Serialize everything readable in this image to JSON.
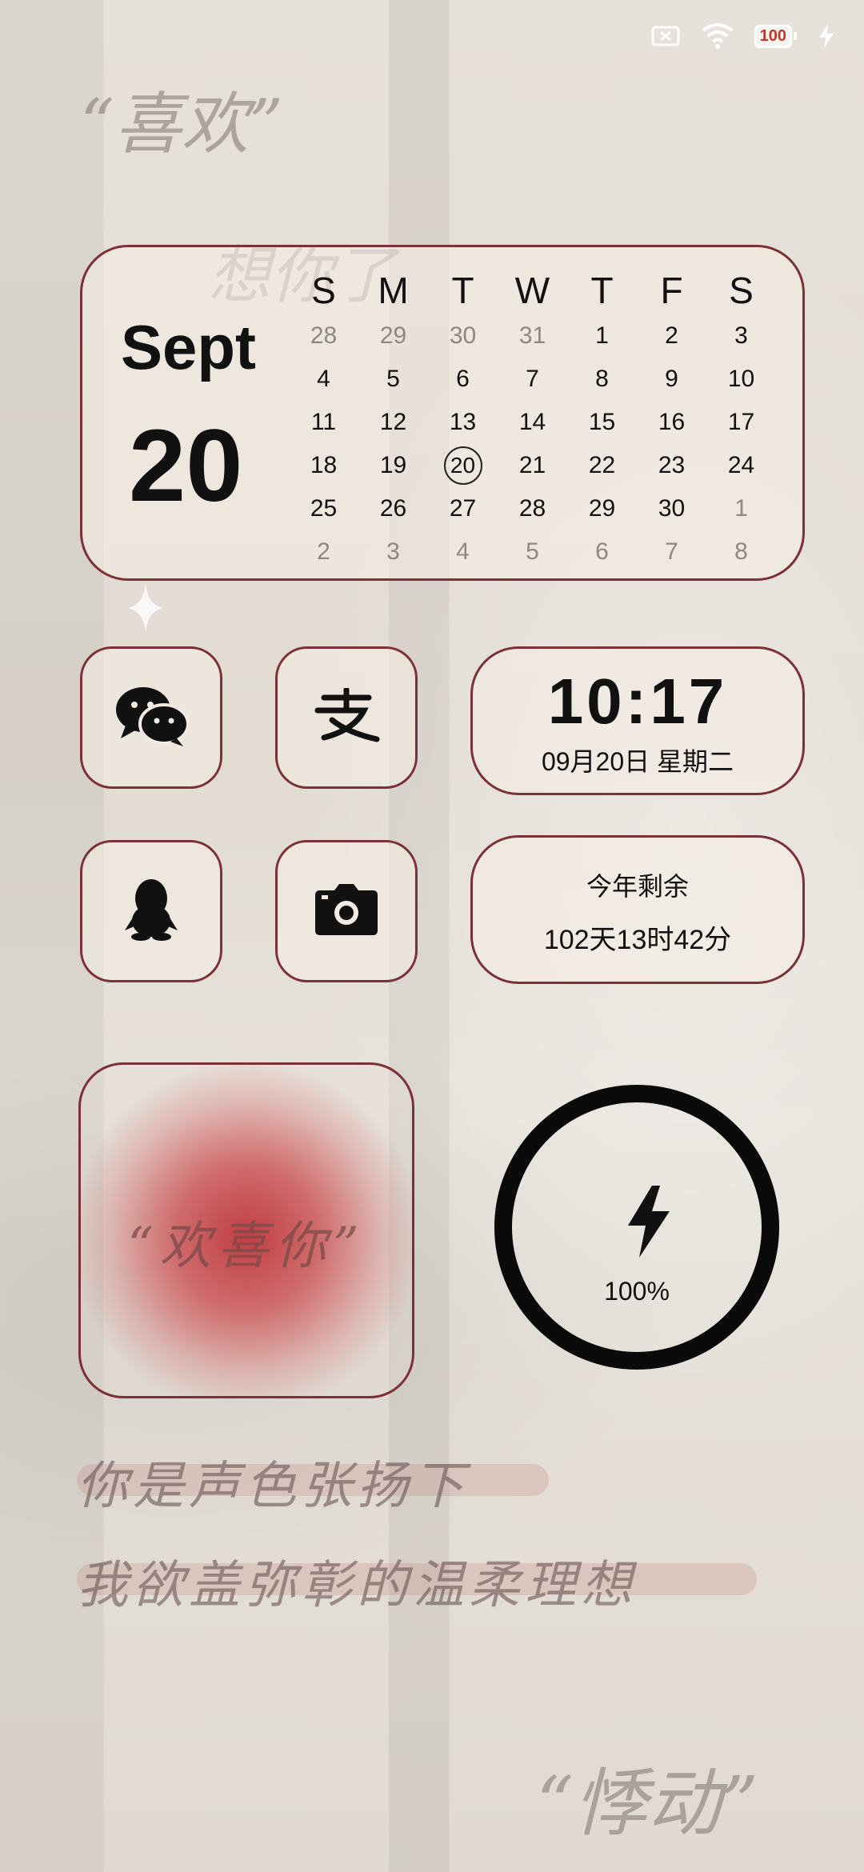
{
  "status": {
    "battery_text": "100",
    "icons": [
      "no-sim-icon",
      "wifi-icon",
      "battery-icon",
      "charging-icon"
    ]
  },
  "decor": {
    "top_quote": "“喜欢”",
    "top_script": "想你了",
    "bottom_quote": "“悸动”"
  },
  "calendar": {
    "month": "Sept",
    "day": "20",
    "weekdays": [
      "S",
      "M",
      "T",
      "W",
      "T",
      "F",
      "S"
    ],
    "rows": [
      [
        "28",
        "29",
        "30",
        "31",
        "1",
        "2",
        "3"
      ],
      [
        "4",
        "5",
        "6",
        "7",
        "8",
        "9",
        "10"
      ],
      [
        "11",
        "12",
        "13",
        "14",
        "15",
        "16",
        "17"
      ],
      [
        "18",
        "19",
        "20",
        "21",
        "22",
        "23",
        "24"
      ],
      [
        "25",
        "26",
        "27",
        "28",
        "29",
        "30",
        "1"
      ],
      [
        "2",
        "3",
        "4",
        "5",
        "6",
        "7",
        "8"
      ]
    ]
  },
  "apps": {
    "wechat": "wechat-icon",
    "alipay": "alipay-icon",
    "qq": "qq-icon",
    "camera": "camera-icon"
  },
  "clock": {
    "time": "10:17",
    "date": "09月20日 星期二"
  },
  "year_remaining": {
    "label": "今年剩余",
    "value": "102天13时42分"
  },
  "photo_widget": {
    "quote": "“欢喜你”"
  },
  "battery_widget": {
    "percent_text": "100%",
    "level": 1.0
  },
  "lyrics": {
    "line1": "你是声色张扬下",
    "line2": "我欲盖弥彰的温柔理想"
  },
  "colors": {
    "border": "#7b3135",
    "accent_red": "#bf373c",
    "text": "#111111"
  }
}
